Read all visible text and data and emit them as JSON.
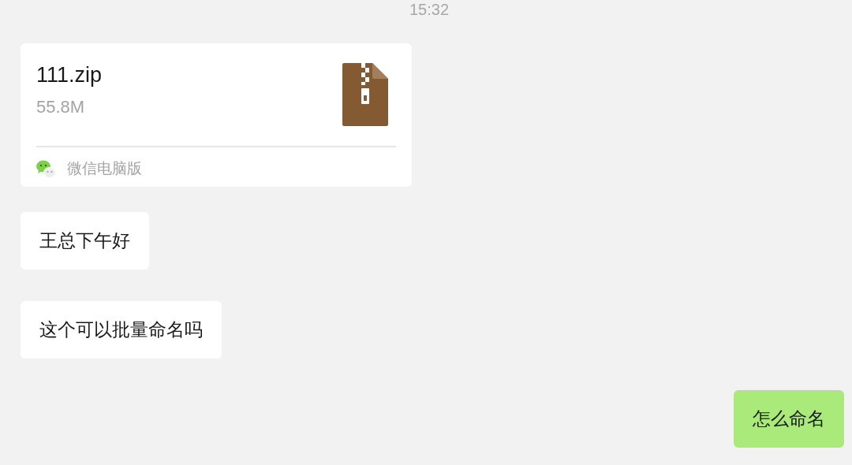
{
  "timestamp": "15:32",
  "messages": [
    {
      "kind": "file",
      "outgoing": false,
      "file_name": "111.zip",
      "file_size": "55.8M",
      "source": "微信电脑版"
    },
    {
      "kind": "text",
      "outgoing": false,
      "text": "王总下午好"
    },
    {
      "kind": "text",
      "outgoing": false,
      "text": "这个可以批量命名吗"
    },
    {
      "kind": "text",
      "outgoing": true,
      "text": "怎么命名"
    }
  ]
}
